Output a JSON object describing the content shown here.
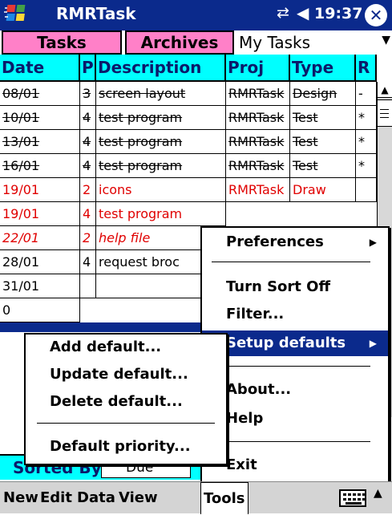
{
  "titlebar": {
    "app_title": "RMRTask",
    "clock": "19:37"
  },
  "tabs": {
    "tasks": "Tasks",
    "archives": "Archives"
  },
  "list_select": {
    "value": "My Tasks"
  },
  "grid": {
    "headers": [
      "Date",
      "P",
      "Description",
      "Proj",
      "Type",
      "R"
    ],
    "rows": [
      [
        "08/01",
        "3",
        "screen layout",
        "RMRTask",
        "Design",
        "-"
      ],
      [
        "10/01",
        "4",
        "test program",
        "RMRTask",
        "Test",
        "*"
      ],
      [
        "13/01",
        "4",
        "test program",
        "RMRTask",
        "Test",
        "*"
      ],
      [
        "16/01",
        "4",
        "test program",
        "RMRTask",
        "Test",
        "*"
      ],
      [
        "19/01",
        "2",
        "icons",
        "RMRTask",
        "Draw",
        ""
      ],
      [
        "19/01",
        "4",
        "test program",
        "",
        "",
        ""
      ],
      [
        "22/01",
        "2",
        "help file",
        "",
        "",
        ""
      ],
      [
        "28/01",
        "4",
        "request broc",
        "",
        "",
        ""
      ],
      [
        "31/01",
        "",
        "",
        "",
        "",
        ""
      ],
      [
        "0",
        "",
        "",
        "",
        "",
        ""
      ]
    ]
  },
  "sorted": {
    "label": "Sorted By:",
    "value": "Due"
  },
  "tools_menu": {
    "preferences": "Preferences",
    "turn_sort_off": "Turn Sort Off",
    "filter": "Filter...",
    "setup_defaults": "Setup defaults",
    "about": "About...",
    "help": "Help",
    "exit": "Exit"
  },
  "defaults_menu": {
    "add": "Add default...",
    "update": "Update default...",
    "delete": "Delete default...",
    "priority": "Default priority..."
  },
  "cmdbar": {
    "new": "New",
    "edit": "Edit",
    "data": "Data",
    "view": "View",
    "tools": "Tools"
  },
  "colors": {
    "titlebar": "#0b2a8c",
    "tab": "#ff80c8",
    "header": "#00ffff",
    "overdue": "#e00000",
    "selection": "#0b2a8c"
  }
}
